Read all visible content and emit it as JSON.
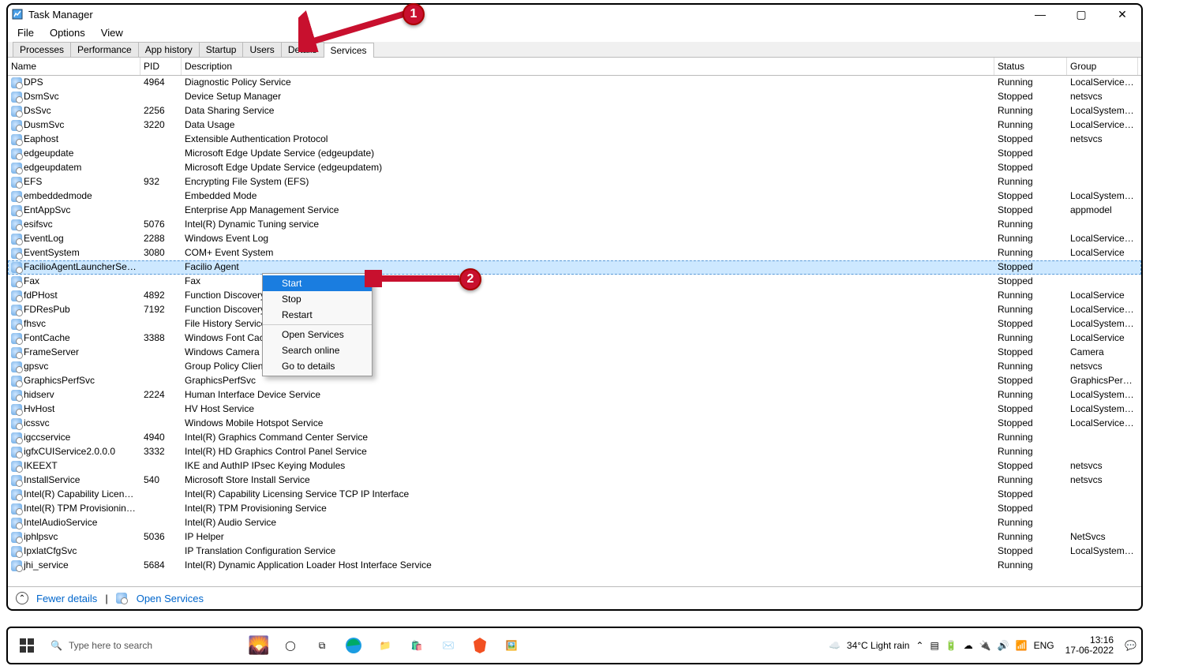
{
  "window": {
    "title": "Task Manager",
    "menu": [
      "File",
      "Options",
      "View"
    ],
    "tabs": [
      "Processes",
      "Performance",
      "App history",
      "Startup",
      "Users",
      "Details",
      "Services"
    ],
    "active_tab": "Services",
    "win_controls": {
      "minimize": "—",
      "maximize": "▢",
      "close": "✕"
    }
  },
  "columns": [
    "Name",
    "PID",
    "Description",
    "Status",
    "Group"
  ],
  "services": [
    {
      "name": "DPS",
      "pid": "4964",
      "desc": "Diagnostic Policy Service",
      "status": "Running",
      "group": "LocalServiceNo..."
    },
    {
      "name": "DsmSvc",
      "pid": "",
      "desc": "Device Setup Manager",
      "status": "Stopped",
      "group": "netsvcs"
    },
    {
      "name": "DsSvc",
      "pid": "2256",
      "desc": "Data Sharing Service",
      "status": "Running",
      "group": "LocalSystemNe..."
    },
    {
      "name": "DusmSvc",
      "pid": "3220",
      "desc": "Data Usage",
      "status": "Running",
      "group": "LocalServiceNe..."
    },
    {
      "name": "Eaphost",
      "pid": "",
      "desc": "Extensible Authentication Protocol",
      "status": "Stopped",
      "group": "netsvcs"
    },
    {
      "name": "edgeupdate",
      "pid": "",
      "desc": "Microsoft Edge Update Service (edgeupdate)",
      "status": "Stopped",
      "group": ""
    },
    {
      "name": "edgeupdatem",
      "pid": "",
      "desc": "Microsoft Edge Update Service (edgeupdatem)",
      "status": "Stopped",
      "group": ""
    },
    {
      "name": "EFS",
      "pid": "932",
      "desc": "Encrypting File System (EFS)",
      "status": "Running",
      "group": ""
    },
    {
      "name": "embeddedmode",
      "pid": "",
      "desc": "Embedded Mode",
      "status": "Stopped",
      "group": "LocalSystemNe..."
    },
    {
      "name": "EntAppSvc",
      "pid": "",
      "desc": "Enterprise App Management Service",
      "status": "Stopped",
      "group": "appmodel"
    },
    {
      "name": "esifsvc",
      "pid": "5076",
      "desc": "Intel(R) Dynamic Tuning service",
      "status": "Running",
      "group": ""
    },
    {
      "name": "EventLog",
      "pid": "2288",
      "desc": "Windows Event Log",
      "status": "Running",
      "group": "LocalServiceNe..."
    },
    {
      "name": "EventSystem",
      "pid": "3080",
      "desc": "COM+ Event System",
      "status": "Running",
      "group": "LocalService"
    },
    {
      "name": "FacilioAgentLauncherService",
      "pid": "",
      "desc": "Facilio Agent",
      "status": "Stopped",
      "group": "",
      "selected": true
    },
    {
      "name": "Fax",
      "pid": "",
      "desc": "Fax",
      "status": "Stopped",
      "group": ""
    },
    {
      "name": "fdPHost",
      "pid": "4892",
      "desc": "Function Discovery",
      "status": "Running",
      "group": "LocalService"
    },
    {
      "name": "FDResPub",
      "pid": "7192",
      "desc": "Function Discovery",
      "status": "Running",
      "group": "LocalServiceAn..."
    },
    {
      "name": "fhsvc",
      "pid": "",
      "desc": "File History Service",
      "status": "Stopped",
      "group": "LocalSystemNe..."
    },
    {
      "name": "FontCache",
      "pid": "3388",
      "desc": "Windows Font Cac",
      "status": "Running",
      "group": "LocalService"
    },
    {
      "name": "FrameServer",
      "pid": "",
      "desc": "Windows Camera",
      "status": "Stopped",
      "group": "Camera"
    },
    {
      "name": "gpsvc",
      "pid": "",
      "desc": "Group Policy Client",
      "status": "Running",
      "group": "netsvcs"
    },
    {
      "name": "GraphicsPerfSvc",
      "pid": "",
      "desc": "GraphicsPerfSvc",
      "status": "Stopped",
      "group": "GraphicsPerfSv..."
    },
    {
      "name": "hidserv",
      "pid": "2224",
      "desc": "Human Interface Device Service",
      "status": "Running",
      "group": "LocalSystemNe..."
    },
    {
      "name": "HvHost",
      "pid": "",
      "desc": "HV Host Service",
      "status": "Stopped",
      "group": "LocalSystemNe..."
    },
    {
      "name": "icssvc",
      "pid": "",
      "desc": "Windows Mobile Hotspot Service",
      "status": "Stopped",
      "group": "LocalServiceNe..."
    },
    {
      "name": "igccservice",
      "pid": "4940",
      "desc": "Intel(R) Graphics Command Center Service",
      "status": "Running",
      "group": ""
    },
    {
      "name": "igfxCUIService2.0.0.0",
      "pid": "3332",
      "desc": "Intel(R) HD Graphics Control Panel Service",
      "status": "Running",
      "group": ""
    },
    {
      "name": "IKEEXT",
      "pid": "",
      "desc": "IKE and AuthIP IPsec Keying Modules",
      "status": "Stopped",
      "group": "netsvcs"
    },
    {
      "name": "InstallService",
      "pid": "540",
      "desc": "Microsoft Store Install Service",
      "status": "Running",
      "group": "netsvcs"
    },
    {
      "name": "Intel(R) Capability Licensing...",
      "pid": "",
      "desc": "Intel(R) Capability Licensing Service TCP IP Interface",
      "status": "Stopped",
      "group": ""
    },
    {
      "name": "Intel(R) TPM Provisioning Se...",
      "pid": "",
      "desc": "Intel(R) TPM Provisioning Service",
      "status": "Stopped",
      "group": ""
    },
    {
      "name": "IntelAudioService",
      "pid": "",
      "desc": "Intel(R) Audio Service",
      "status": "Running",
      "group": ""
    },
    {
      "name": "iphlpsvc",
      "pid": "5036",
      "desc": "IP Helper",
      "status": "Running",
      "group": "NetSvcs"
    },
    {
      "name": "IpxlatCfgSvc",
      "pid": "",
      "desc": "IP Translation Configuration Service",
      "status": "Stopped",
      "group": "LocalSystemNe..."
    },
    {
      "name": "jhi_service",
      "pid": "5684",
      "desc": "Intel(R) Dynamic Application Loader Host Interface Service",
      "status": "Running",
      "group": ""
    }
  ],
  "context_menu": {
    "items": [
      "Start",
      "Stop",
      "Restart",
      "Open Services",
      "Search online",
      "Go to details"
    ],
    "highlighted": "Start"
  },
  "footer": {
    "fewer": "Fewer details",
    "open": "Open Services"
  },
  "annotations": {
    "b1": "1",
    "b2": "2"
  },
  "taskbar": {
    "search_placeholder": "Type here to search",
    "weather": "34°C  Light rain",
    "lang": "ENG",
    "time": "13:16",
    "date": "17-06-2022"
  }
}
